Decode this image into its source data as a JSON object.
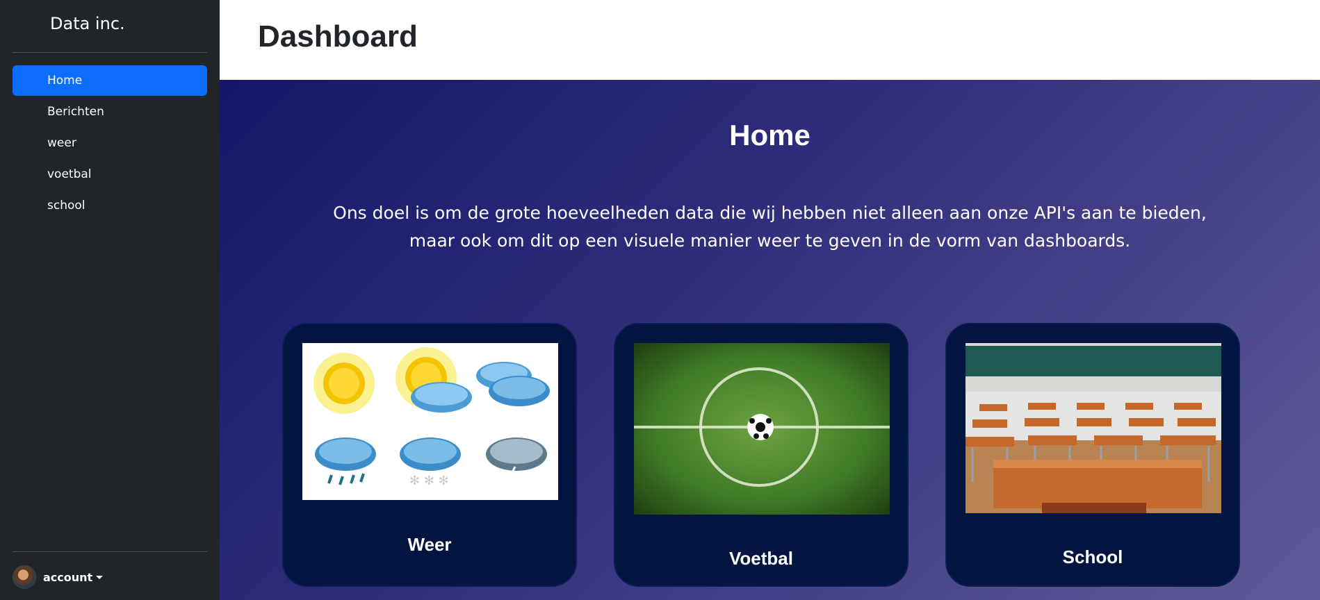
{
  "sidebar": {
    "brand": "Data inc.",
    "items": [
      {
        "label": "Home",
        "active": true
      },
      {
        "label": "Berichten",
        "active": false
      },
      {
        "label": "weer",
        "active": false
      },
      {
        "label": "voetbal",
        "active": false
      },
      {
        "label": "school",
        "active": false
      }
    ],
    "account_label": "account"
  },
  "header": {
    "title": "Dashboard"
  },
  "main": {
    "title": "Home",
    "intro_line1": "Ons doel is om de grote hoeveelheden data die wij hebben niet alleen aan onze API's aan te bieden,",
    "intro_line2": "maar ook om dit op een visuele manier weer te geven in de vorm van dashboards.",
    "cards": [
      {
        "label": "Weer",
        "image": "weather-icons-image"
      },
      {
        "label": "Voetbal",
        "image": "football-field-image"
      },
      {
        "label": "School",
        "image": "classroom-image"
      }
    ]
  },
  "colors": {
    "sidebar_bg": "#212529",
    "active_nav": "#0d6efd",
    "card_bg": "#021440",
    "gradient_start": "#14176a",
    "gradient_end": "#5f5b98"
  }
}
